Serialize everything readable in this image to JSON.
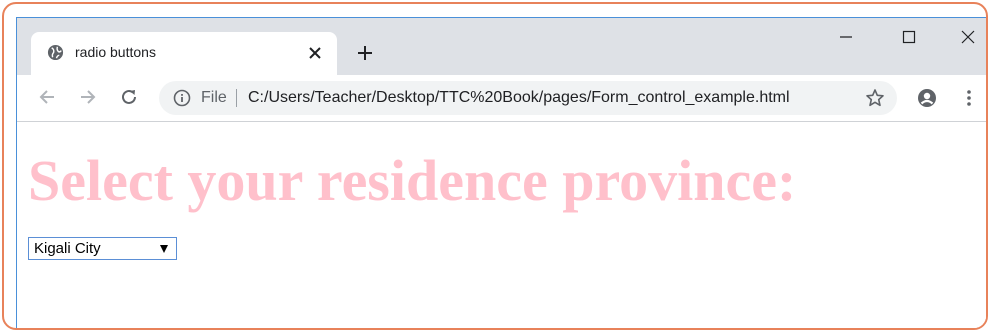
{
  "browser": {
    "tab": {
      "title": "radio buttons",
      "icon": "globe-icon"
    },
    "window_controls": [
      "minimize-icon",
      "maximize-icon",
      "close-icon"
    ],
    "address_bar": {
      "scheme_label": "File",
      "url": "C:/Users/Teacher/Desktop/TTC%20Book/pages/Form_control_example.html"
    }
  },
  "page": {
    "heading": "Select your residence province:",
    "heading_color": "#ffc0cb",
    "province_select": {
      "selected": "Kigali City"
    }
  },
  "colors": {
    "frame_border": "#e8825a",
    "window_border": "#4a90d9",
    "tabstrip_bg": "#dee1e6"
  }
}
